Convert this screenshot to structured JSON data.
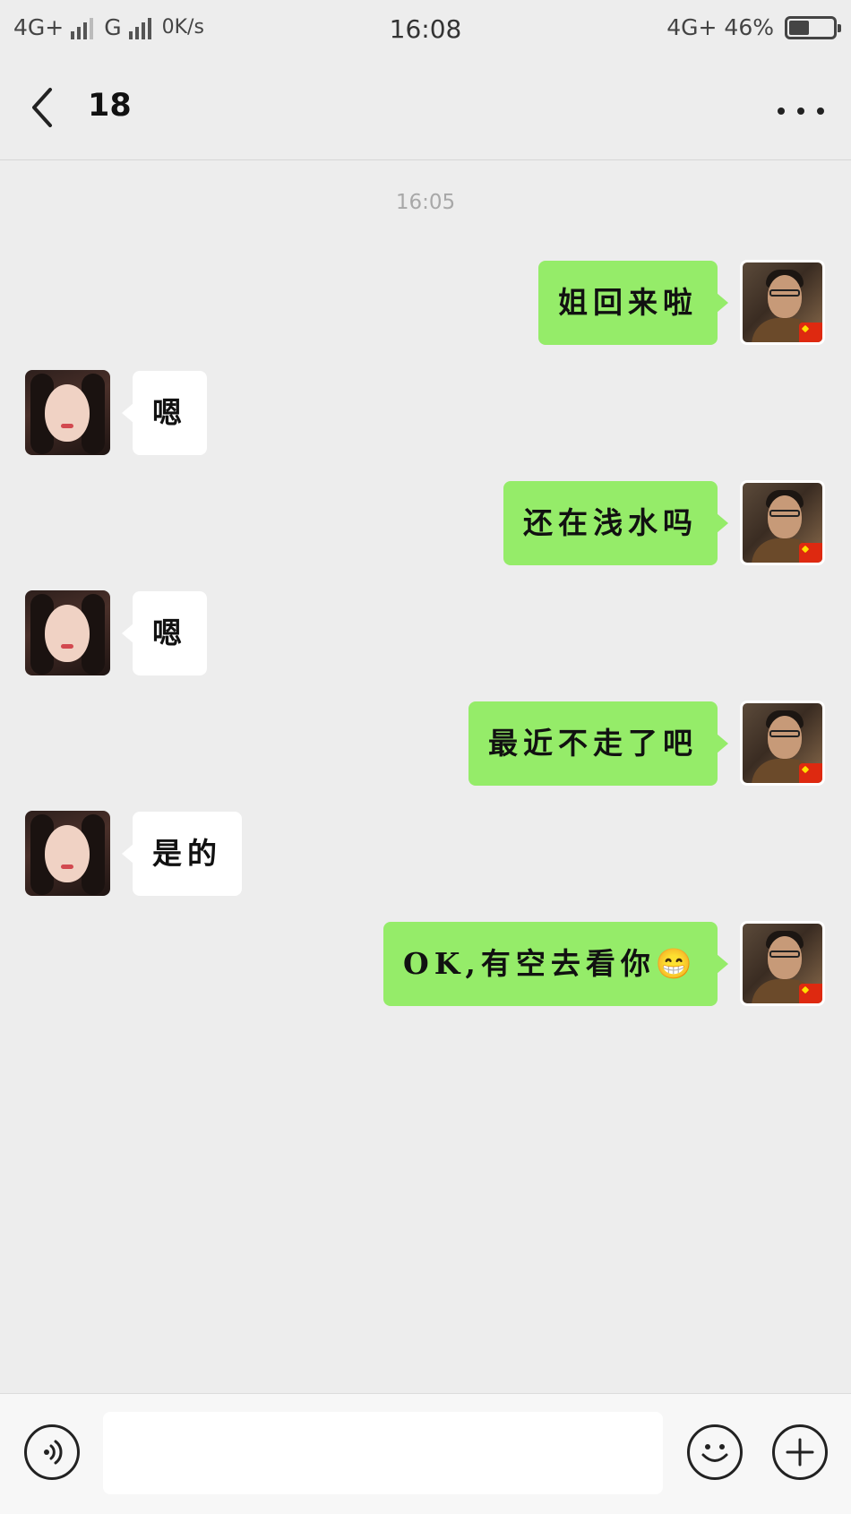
{
  "status_bar": {
    "network_1": "4G+",
    "network_2": "G",
    "speed": "0K/s",
    "time": "16:08",
    "network_right": "4G",
    "network_right_suffix": "+",
    "battery_percent": "46%",
    "battery_level": 0.46
  },
  "header": {
    "title": "18",
    "back_icon": "chevron-left-icon",
    "more_icon": "more-dots-icon"
  },
  "chat": {
    "timestamp": "16:05",
    "messages": [
      {
        "side": "self",
        "text": "姐回来啦"
      },
      {
        "side": "other",
        "text": "嗯"
      },
      {
        "side": "self",
        "text": "还在浅水吗"
      },
      {
        "side": "other",
        "text": "嗯"
      },
      {
        "side": "self",
        "text": "最近不走了吧"
      },
      {
        "side": "other",
        "text": "是的"
      },
      {
        "side": "self",
        "text": "OK,有空去看你😁"
      }
    ]
  },
  "input_bar": {
    "voice_icon": "voice-icon",
    "emoji_icon": "emoji-icon",
    "plus_icon": "plus-icon",
    "value": ""
  },
  "colors": {
    "background": "#ededed",
    "self_bubble": "#95ec69",
    "other_bubble": "#ffffff",
    "timestamp": "#a8a8a8"
  }
}
